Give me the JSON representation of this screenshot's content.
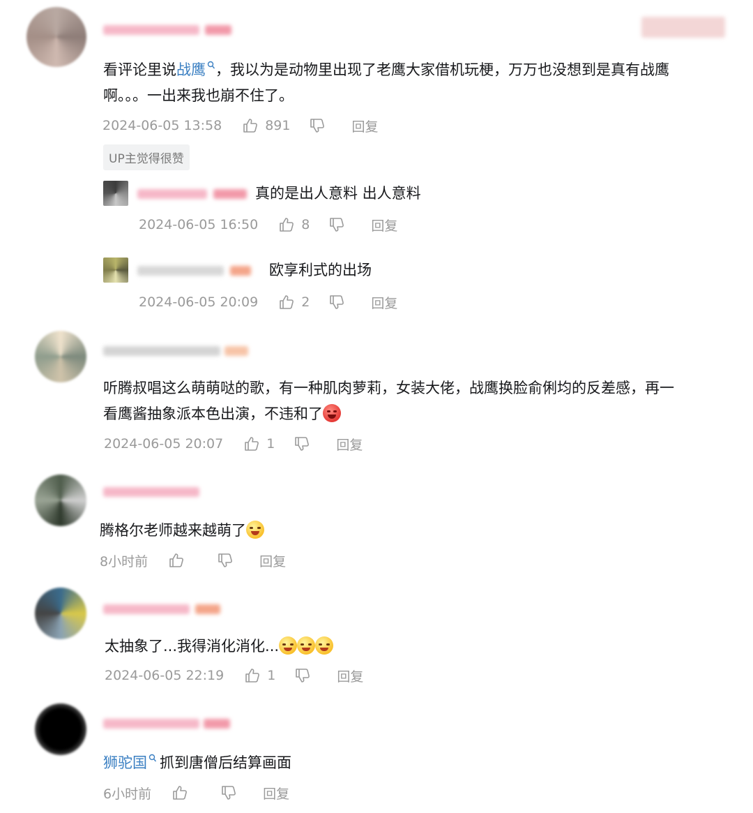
{
  "comments": [
    {
      "text_before": "看评论里说",
      "link": "战鹰",
      "text_after": "，我以为是动物里出现了老鹰大家借机玩梗，万万也没想到是真有战鹰",
      "text_line2": "啊。。。一出来我也崩不住了。",
      "date": "2024-06-05 13:58",
      "likes": "891",
      "reply_label": "回复",
      "badge": "UP主觉得很赞",
      "replies": [
        {
          "text": "真的是出人意料 出人意料",
          "date": "2024-06-05 16:50",
          "likes": "8",
          "reply_label": "回复"
        },
        {
          "text": "欧享利式的出场",
          "date": "2024-06-05 20:09",
          "likes": "2",
          "reply_label": "回复"
        }
      ]
    },
    {
      "text_line1": "听腾叔唱这么萌萌哒的歌，有一种肌肉萝莉，女装大佬，战鹰换脸俞俐均的反差感，再一",
      "text_line2": "看鹰酱抽象派本色出演，不违和了",
      "date": "2024-06-05 20:07",
      "likes": "1",
      "reply_label": "回复"
    },
    {
      "text": "腾格尔老师越来越萌了",
      "date": "8小时前",
      "likes": "",
      "reply_label": "回复"
    },
    {
      "text": "太抽象了...我得消化消化...",
      "date": "2024-06-05 22:19",
      "likes": "1",
      "reply_label": "回复"
    },
    {
      "link": "狮驼国",
      "text_after": "抓到唐僧后结算画面",
      "date": "6小时前",
      "likes": "",
      "reply_label": "回复"
    }
  ],
  "icons": {
    "search": "search-icon",
    "like": "thumbs-up-icon",
    "dislike": "thumbs-down-icon",
    "emoji_heart": "heart-eyes-emoji",
    "emoji_laugh": "laughing-tears-emoji",
    "emoji_cry": "crying-emoji"
  },
  "colors": {
    "link": "#3a7fc2",
    "meta": "#9a9a9a",
    "text": "#18191c",
    "badge_bg": "#f1f2f3"
  }
}
